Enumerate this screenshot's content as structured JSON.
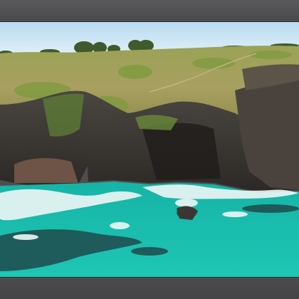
{
  "photo": {
    "subject": "aerial-coastal-cliff",
    "colors": {
      "sky": "#cfe6f5",
      "grass": "#8a9a4a",
      "rock": "#3e3a36",
      "sea": "#19b7a5",
      "surf": "#e9f4f3",
      "frame": "#4e4e50"
    }
  }
}
